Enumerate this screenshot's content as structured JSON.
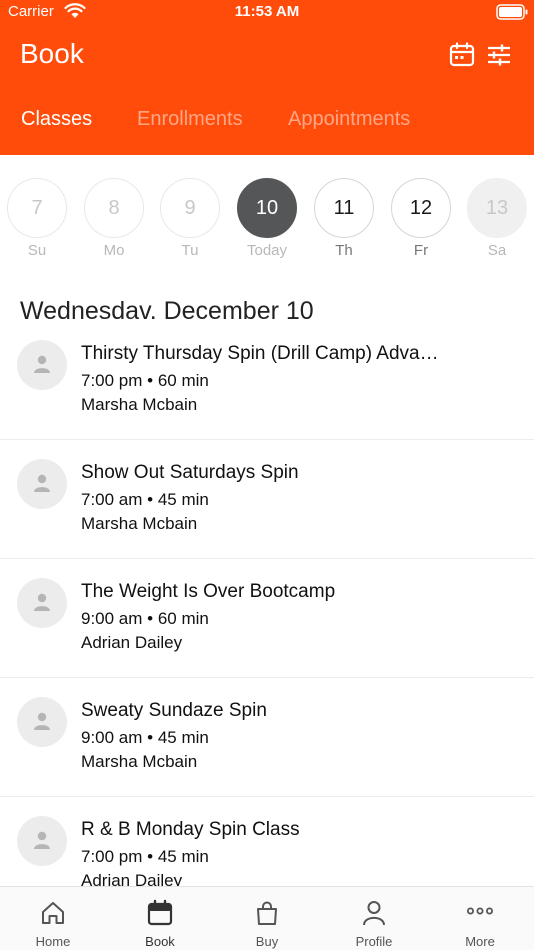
{
  "status_bar": {
    "carrier": "Carrier",
    "time": "11:53 AM"
  },
  "header": {
    "title": "Book",
    "icons": [
      "calendar-icon",
      "filter-sliders-icon"
    ],
    "accent_color": "#ff4c0b",
    "tabs": [
      {
        "label": "Classes",
        "active": true
      },
      {
        "label": "Enrollments",
        "active": false
      },
      {
        "label": "Appointments",
        "active": false
      }
    ]
  },
  "date_strip": [
    {
      "day": "7",
      "label": "Su",
      "state": "past"
    },
    {
      "day": "8",
      "label": "Mo",
      "state": "past"
    },
    {
      "day": "9",
      "label": "Tu",
      "state": "past"
    },
    {
      "day": "10",
      "label": "Today",
      "state": "selected"
    },
    {
      "day": "11",
      "label": "Th",
      "state": "future"
    },
    {
      "day": "12",
      "label": "Fr",
      "state": "future"
    },
    {
      "day": "13",
      "label": "Sa",
      "state": "unavailable"
    }
  ],
  "date_heading": "Wednesdav. December 10",
  "classes": [
    {
      "title": "Thirsty Thursday Spin (Drill Camp) Adva…",
      "time": "7:00 pm • 60 min",
      "instructor": "Marsha Mcbain"
    },
    {
      "title": "Show Out Saturdays Spin",
      "time": "7:00 am • 45 min",
      "instructor": "Marsha Mcbain"
    },
    {
      "title": "The Weight Is Over Bootcamp",
      "time": "9:00 am • 60 min",
      "instructor": "Adrian Dailey"
    },
    {
      "title": "Sweaty Sundaze Spin",
      "time": "9:00 am • 45 min",
      "instructor": "Marsha Mcbain"
    },
    {
      "title": "R & B Monday Spin Class",
      "time": "7:00 pm • 45 min",
      "instructor": "Adrian Dailey"
    }
  ],
  "tab_bar": [
    {
      "label": "Home",
      "icon": "home-icon"
    },
    {
      "label": "Book",
      "icon": "calendar-icon",
      "active": true
    },
    {
      "label": "Buy",
      "icon": "shopping-bag-icon"
    },
    {
      "label": "Profile",
      "icon": "person-icon"
    },
    {
      "label": "More",
      "icon": "more-dots-icon"
    }
  ]
}
